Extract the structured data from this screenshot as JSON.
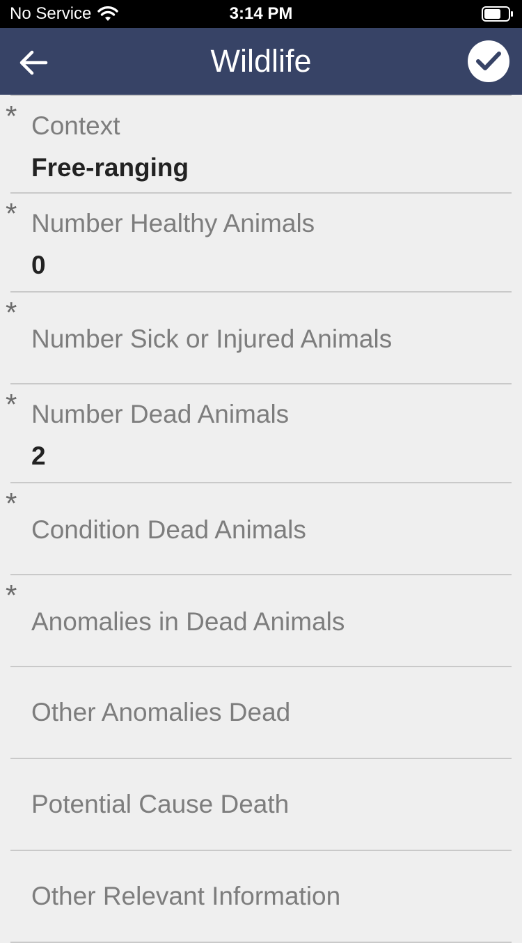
{
  "status_bar": {
    "carrier": "No Service",
    "time": "3:14 PM"
  },
  "nav": {
    "title": "Wildlife",
    "back_icon": "back-arrow-icon",
    "confirm_icon": "checkmark-icon"
  },
  "fields": [
    {
      "label": "Context",
      "value": "Free-ranging",
      "required": true
    },
    {
      "label": "Number Healthy Animals",
      "value": "0",
      "required": true
    },
    {
      "label": "Number Sick or Injured Animals",
      "value": "",
      "required": true
    },
    {
      "label": "Number Dead Animals",
      "value": "2",
      "required": true
    },
    {
      "label": "Condition Dead Animals",
      "value": "",
      "required": true
    },
    {
      "label": "Anomalies in Dead Animals",
      "value": "",
      "required": true
    },
    {
      "label": "Other Anomalies Dead",
      "value": "",
      "required": false
    },
    {
      "label": "Potential Cause Death",
      "value": "",
      "required": false
    },
    {
      "label": "Other Relevant Information",
      "value": "",
      "required": false
    }
  ],
  "required_marker": "*",
  "colors": {
    "nav_background": "#374366",
    "page_background": "#efefef",
    "label_text": "#7d7d7d",
    "value_text": "#222222"
  }
}
